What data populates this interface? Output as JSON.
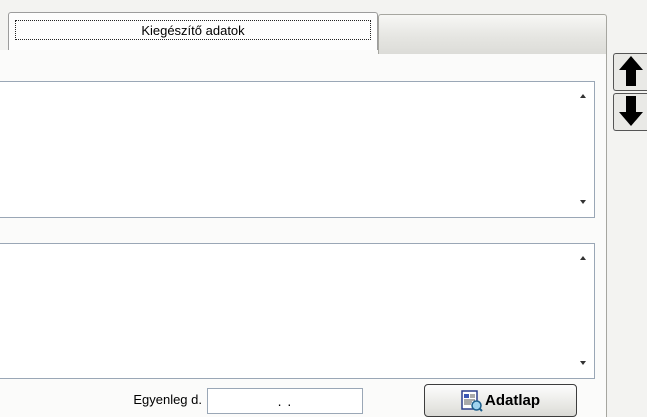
{
  "tabs": [
    {
      "label": "Kiegészítő adatok",
      "active": true
    },
    {
      "label": "",
      "active": false
    }
  ],
  "bottom": {
    "balance_label": "Egyenleg d.",
    "balance_value": ". .",
    "datasheet_button": "Adatlap"
  },
  "icons": {
    "textarea_scroll_up": "triangle-up",
    "textarea_scroll_down": "triangle-down",
    "nav_up": "arrow-up",
    "nav_down": "arrow-down",
    "datasheet": "document-magnifier"
  }
}
